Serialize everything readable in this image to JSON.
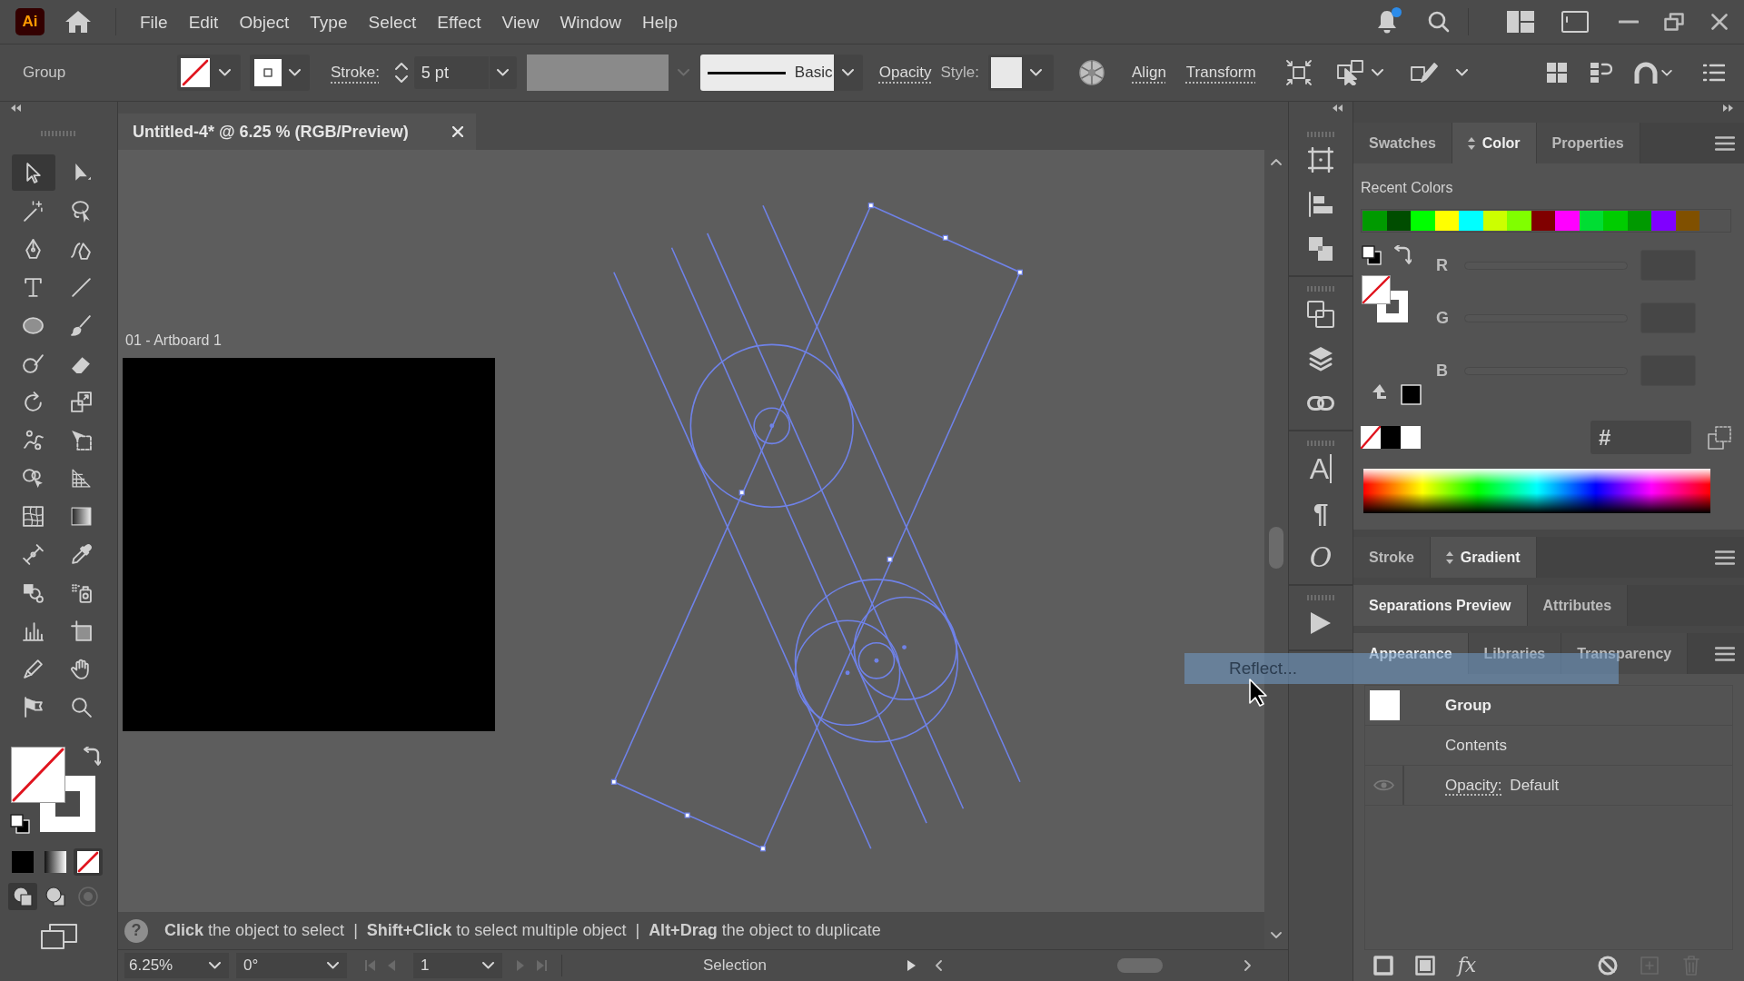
{
  "app_logo": "Ai",
  "menu_bar": {
    "items": [
      "File",
      "Edit",
      "Object",
      "Type",
      "Select",
      "Effect",
      "View",
      "Window",
      "Help"
    ]
  },
  "title_bar": {
    "notifications_unread": true
  },
  "control_bar": {
    "selection": "Group",
    "stroke_label": "Stroke:",
    "stroke_weight": "5 pt",
    "stroke_profile": "Basic",
    "opacity_label": "Opacity",
    "style_label": "Style:",
    "align_label": "Align",
    "transform_label": "Transform"
  },
  "tools": [
    {
      "kind": "selection",
      "selected": true
    },
    {
      "kind": "direct_selection",
      "selected": false
    },
    {
      "kind": "magic_wand",
      "selected": false
    },
    {
      "kind": "lasso",
      "selected": false
    },
    {
      "kind": "pen",
      "selected": false
    },
    {
      "kind": "curvature",
      "selected": false
    },
    {
      "kind": "type",
      "selected": false
    },
    {
      "kind": "line",
      "selected": false
    },
    {
      "kind": "ellipse",
      "selected": false
    },
    {
      "kind": "paintbrush",
      "selected": false
    },
    {
      "kind": "shaper",
      "selected": false
    },
    {
      "kind": "eraser",
      "selected": false
    },
    {
      "kind": "rotate",
      "selected": false
    },
    {
      "kind": "scale",
      "selected": false
    },
    {
      "kind": "puppet_warp",
      "selected": false
    },
    {
      "kind": "free_transform",
      "selected": false
    },
    {
      "kind": "shape_builder",
      "selected": false
    },
    {
      "kind": "perspective_grid",
      "selected": false
    },
    {
      "kind": "mesh",
      "selected": false
    },
    {
      "kind": "gradient",
      "selected": false
    },
    {
      "kind": "blend",
      "selected": false
    },
    {
      "kind": "eyedropper",
      "selected": false
    },
    {
      "kind": "symbol_sprayer",
      "selected": false
    },
    {
      "kind": "live_paint",
      "selected": false
    },
    {
      "kind": "column_graph",
      "selected": false
    },
    {
      "kind": "artboard",
      "selected": false
    },
    {
      "kind": "knife",
      "selected": false
    },
    {
      "kind": "hand",
      "selected": false
    },
    {
      "kind": "flag",
      "selected": false
    },
    {
      "kind": "zoom",
      "selected": false
    }
  ],
  "color_modes": [
    {
      "kind": "color",
      "selected": false
    },
    {
      "kind": "gradient",
      "selected": false
    },
    {
      "kind": "none",
      "selected": true
    }
  ],
  "draw_modes": [
    {
      "kind": "normal",
      "selected": true,
      "disabled": false
    },
    {
      "kind": "behind",
      "selected": false,
      "disabled": false
    },
    {
      "kind": "inside",
      "selected": false,
      "disabled": true
    }
  ],
  "document_tab": {
    "title": "Untitled-4* @ 6.25 % (RGB/Preview)"
  },
  "canvas": {
    "artboard_label": "01 - Artboard 1"
  },
  "status_bar": {
    "help_glyph": "?",
    "hint": "**Click** the object to select  |  **Shift+Click** to select multiple object  |  **Alt+Drag** the object to duplicate"
  },
  "bottom_bar": {
    "zoom": "6.25%",
    "rotation": "0°",
    "artboard": "1",
    "artboard_nav": [
      {
        "kind": "first",
        "disabled": true
      },
      {
        "kind": "previous",
        "disabled": true
      },
      {
        "kind": "next",
        "disabled": true
      },
      {
        "kind": "last",
        "disabled": true
      }
    ],
    "tool": "Selection"
  },
  "dock": {
    "groups": [
      {
        "items": [
          {
            "kind": "artboards"
          },
          {
            "kind": "align"
          },
          {
            "kind": "pathfinder"
          }
        ]
      },
      {
        "items": [
          {
            "kind": "transform"
          },
          {
            "kind": "layers"
          },
          {
            "kind": "links"
          }
        ]
      },
      {
        "items": [
          {
            "kind": "character",
            "glyph": "A"
          },
          {
            "kind": "paragraph",
            "glyph": "¶"
          },
          {
            "kind": "opentype",
            "glyph": "O"
          }
        ]
      },
      {
        "items": [
          {
            "kind": "actions"
          }
        ]
      }
    ]
  },
  "panels": [
    {
      "tabs": [
        {
          "label": "Swatches",
          "selected": false,
          "options_toggle": false
        },
        {
          "label": "Color",
          "selected": true,
          "options_toggle": true
        },
        {
          "label": "Properties",
          "selected": false,
          "options_toggle": false
        }
      ],
      "menu": true,
      "color": {
        "recent_label": "Recent Colors",
        "recent_colors": [
          {
            "color": "#009a00"
          },
          {
            "color": "#004d00"
          },
          {
            "color": "#00ff00"
          },
          {
            "color": "#ffff00"
          },
          {
            "color": "#00ffff"
          },
          {
            "color": "#ccff00"
          },
          {
            "color": "#80ff00"
          },
          {
            "color": "#800000"
          },
          {
            "color": "#ff00ff"
          },
          {
            "color": "#00dd33"
          },
          {
            "color": "#00cc00"
          },
          {
            "color": "#009900"
          },
          {
            "color": "#8000ff"
          },
          {
            "color": "#805000"
          }
        ],
        "channels": [
          {
            "label": "R"
          },
          {
            "label": "G"
          },
          {
            "label": "B"
          }
        ],
        "hex_label": "#"
      }
    },
    {
      "tabs": [
        {
          "label": "Stroke",
          "selected": false,
          "options_toggle": false
        },
        {
          "label": "Gradient",
          "selected": true,
          "options_toggle": true
        }
      ],
      "menu": true
    },
    {
      "tabs": [
        {
          "label": "Separations Preview",
          "selected": true,
          "options_toggle": false
        },
        {
          "label": "Attributes",
          "selected": false,
          "options_toggle": false
        }
      ],
      "menu": false
    },
    {
      "tabs": [
        {
          "label": "Appearance",
          "selected": true,
          "options_toggle": false
        },
        {
          "label": "Libraries",
          "selected": false,
          "options_toggle": false
        },
        {
          "label": "Transparency",
          "selected": false,
          "options_toggle": false
        }
      ],
      "menu": true,
      "appearance": {
        "rows": [
          {
            "kind": "target",
            "label": "Group"
          },
          {
            "kind": "contents",
            "label": "Contents"
          },
          {
            "kind": "attribute",
            "label": "Opacity:",
            "value": "Default"
          }
        ],
        "footer_buttons": [
          {
            "kind": "stroke",
            "disabled": false
          },
          {
            "kind": "fill",
            "disabled": false
          },
          {
            "kind": "effects",
            "label": "fx",
            "disabled": false
          },
          {
            "kind": "clear",
            "disabled": false
          },
          {
            "kind": "duplicate",
            "disabled": true
          },
          {
            "kind": "delete",
            "disabled": true
          }
        ]
      }
    }
  ],
  "drag_preview": {
    "label": "Reflect..."
  }
}
